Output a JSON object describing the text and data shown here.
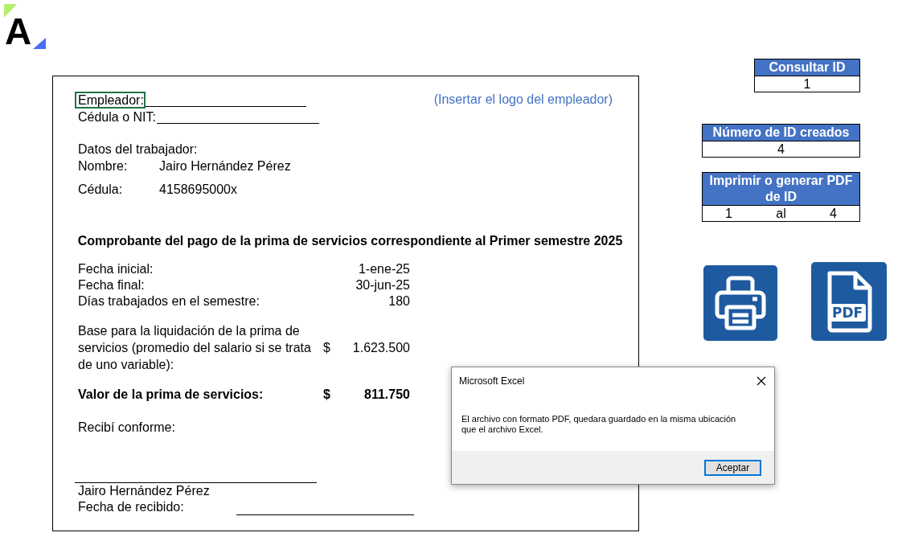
{
  "logo": {
    "letter": "A"
  },
  "employer_fields": [
    {
      "label": "Empleador:",
      "selected": true
    },
    {
      "label": "Cédula o NIT:",
      "selected": false
    }
  ],
  "logo_placeholder": "(Insertar el logo del empleador)",
  "worker": {
    "heading": "Datos del trabajador:",
    "rows": [
      {
        "label": "Nombre:",
        "value": "Jairo Hernández Pérez"
      },
      {
        "label": "Cédula:",
        "value": "4158695000x"
      }
    ]
  },
  "title": "Comprobante del pago de la prima de servicios correspondiente al Primer semestre 2025",
  "dates": [
    {
      "label": "Fecha inicial:",
      "value": "1-ene-25"
    },
    {
      "label": "Fecha final:",
      "value": "30-jun-25"
    },
    {
      "label": "Días trabajados en el semestre:",
      "value": "180"
    }
  ],
  "base": {
    "label": "Base para la liquidación de la prima de servicios (promedio del salario si se trata de uno variable):",
    "currency": "$",
    "value": "1.623.500"
  },
  "total": {
    "label": "Valor de la prima de servicios:",
    "currency": "$",
    "value": "811.750"
  },
  "received": "Recibí conforme:",
  "signature": {
    "name": "Jairo Hernández Pérez",
    "date_label": "Fecha de recibido:"
  },
  "side_panels": [
    {
      "header": "Consultar ID",
      "cells": [
        "1"
      ]
    },
    {
      "header": "Número de ID creados",
      "cells": [
        "4"
      ]
    },
    {
      "header": "Imprimir o generar PDF de ID",
      "cells": [
        "1",
        "al",
        "4"
      ]
    }
  ],
  "pdf_button": {
    "label": "PDF"
  },
  "dialog": {
    "title": "Microsoft Excel",
    "message": "El archivo con formato PDF, quedara guardado en la misma ubicación que el archivo Excel.",
    "button": "Aceptar"
  }
}
